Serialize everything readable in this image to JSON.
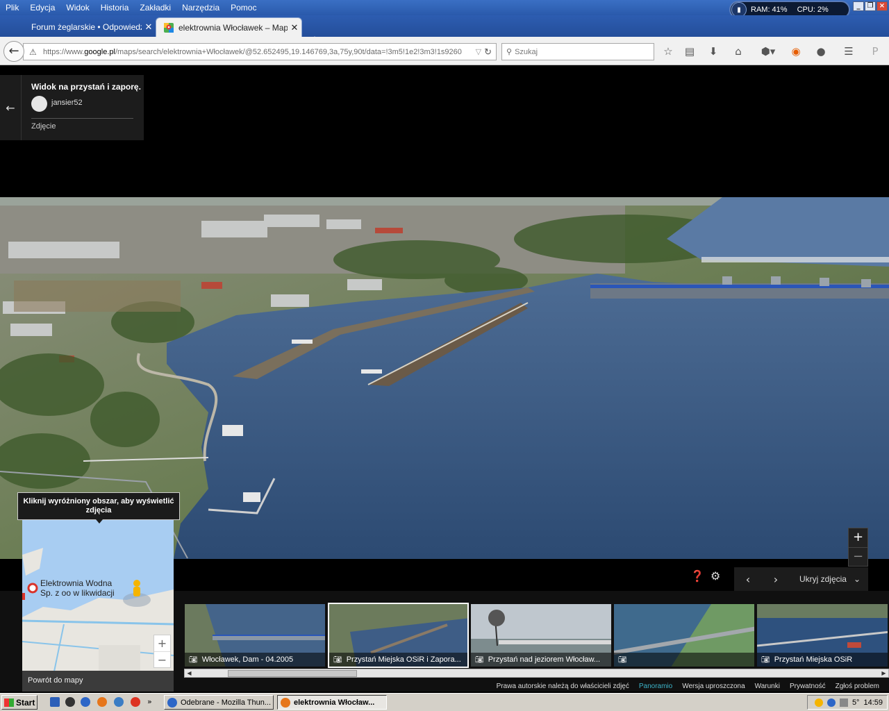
{
  "menu": [
    "Plik",
    "Edycja",
    "Widok",
    "Historia",
    "Zakładki",
    "Narzędzia",
    "Pomoc"
  ],
  "sysmon": {
    "ram": "RAM: 41%",
    "cpu": "CPU: 2%"
  },
  "tabs": [
    {
      "title": "Forum żeglarskie • Odpowiedz",
      "active": false
    },
    {
      "title": "elektrownia Włocławek – Map...",
      "active": true
    }
  ],
  "url": {
    "prefix": "https://www.",
    "domain": "google.pl",
    "rest": "/maps/search/elektrownia+Włocławek/@52.652495,19.146769,3a,75y,90t/data=!3m5!1e2!3m3!1s9260"
  },
  "search": {
    "placeholder": "Szukaj"
  },
  "photo": {
    "title": "Widok na przystań i zaporę.",
    "user": "jansier52",
    "kind": "Zdjęcie"
  },
  "controls": {
    "hide_label": "Ukryj zdjęcia"
  },
  "tooltip": "Kliknij wyróżniony obszar, aby wyświetlić zdjęcia",
  "minimap": {
    "place_line1": "Elektrownia Wodna",
    "place_line2": "Sp. z oo w likwidacji",
    "back": "Powrót do mapy"
  },
  "thumbs": [
    {
      "caption": "Włocławek, Dam - 04.2005"
    },
    {
      "caption": "Przystań Miejska OSiR i Zapora..."
    },
    {
      "caption": "Przystań nad jeziorem Włocław..."
    },
    {
      "caption": ""
    },
    {
      "caption": "Przystań Miejska OSiR"
    }
  ],
  "footer": {
    "copyright": "Prawa autorskie należą do właścicieli zdjęć",
    "panoramio": "Panoramio",
    "simple": "Wersja uproszczona",
    "terms": "Warunki",
    "privacy": "Prywatność",
    "report": "Zgłoś problem"
  },
  "taskbar": {
    "start": "Start",
    "items": [
      {
        "label": "Odebrane - Mozilla Thun..."
      },
      {
        "label": "elektrownia Włocław..."
      }
    ],
    "temp": "5°",
    "time": "14:59"
  }
}
